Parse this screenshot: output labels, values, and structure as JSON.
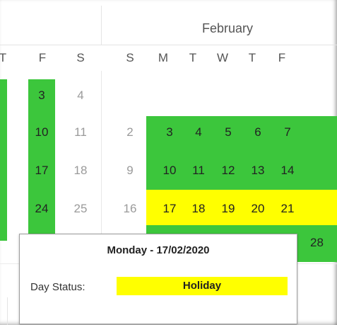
{
  "calendar": {
    "month": "February",
    "day_headers": [
      "T",
      "F",
      "S",
      "S",
      "M",
      "T",
      "W",
      "T",
      "F"
    ],
    "rows": [
      [
        "",
        "3",
        "4",
        "",
        "",
        "",
        "",
        "",
        ""
      ],
      [
        "",
        "10",
        "11",
        "2",
        "3",
        "4",
        "5",
        "6",
        "7"
      ],
      [
        "",
        "17",
        "18",
        "9",
        "10",
        "11",
        "12",
        "13",
        "14"
      ],
      [
        "",
        "24",
        "25",
        "16",
        "17",
        "18",
        "19",
        "20",
        "21"
      ],
      [
        "",
        "",
        "",
        "",
        "",
        "",
        "",
        "",
        "28"
      ]
    ],
    "colors": {
      "working": "#3cc63c",
      "holiday": "#ffff00"
    }
  },
  "tooltip": {
    "title": "Monday - 17/02/2020",
    "label": "Day Status:",
    "status": "Holiday",
    "status_color": "#ffff00"
  }
}
